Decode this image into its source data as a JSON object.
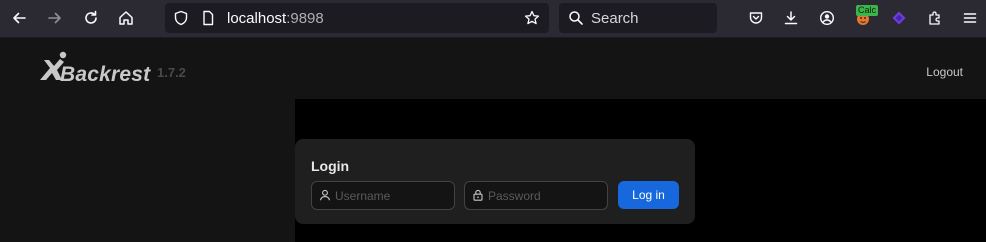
{
  "browser": {
    "url_host": "localhost",
    "url_port": ":9898",
    "search_placeholder": "Search",
    "extension_badge": "Calc",
    "icons": [
      "back-icon",
      "forward-icon",
      "reload-icon",
      "home-icon",
      "shield-icon",
      "page-icon",
      "bookmark-star-icon",
      "search-icon",
      "pocket-icon",
      "download-icon",
      "account-icon",
      "calc-extension-icon",
      "purple-extension-icon",
      "extensions-icon",
      "menu-icon"
    ]
  },
  "header": {
    "logo_text": "Backrest",
    "version": "1.7.2",
    "logout_label": "Logout"
  },
  "login": {
    "title": "Login",
    "username_placeholder": "Username",
    "password_placeholder": "Password",
    "submit_label": "Log in"
  },
  "colors": {
    "primary": "#1668dc",
    "header_bg": "#141414",
    "card_bg": "#1f1f1f",
    "browser_bg": "#2b2a33"
  }
}
